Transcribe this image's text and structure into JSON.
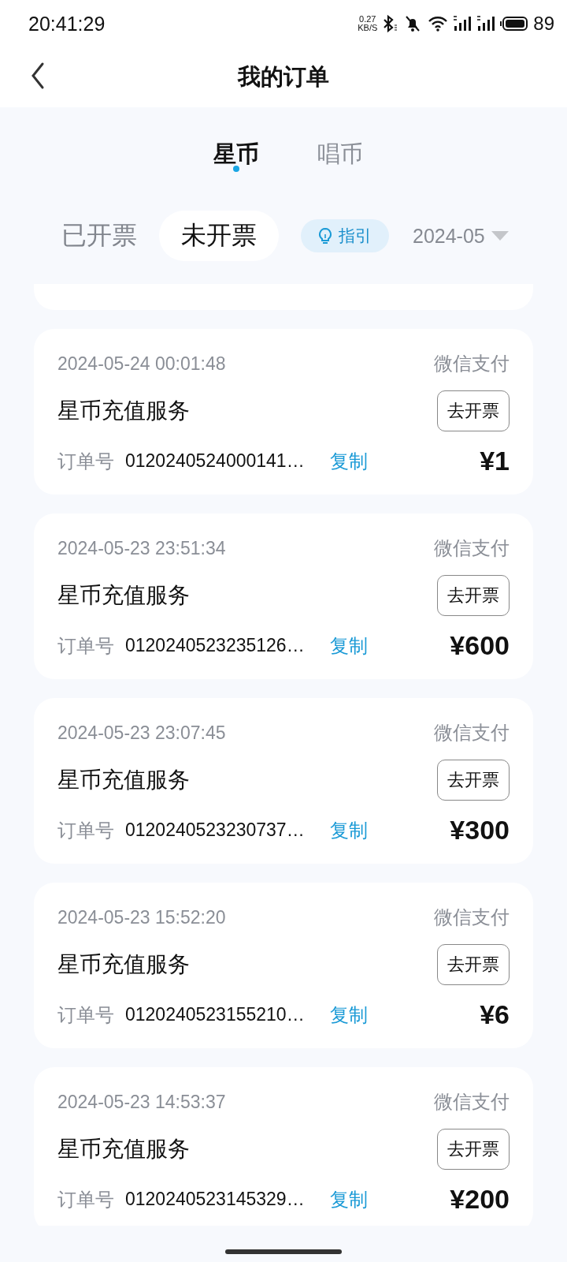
{
  "status_bar": {
    "time": "20:41:29",
    "net_speed_value": "0.27",
    "net_speed_unit": "KB/S",
    "battery": "89"
  },
  "header": {
    "title": "我的订单"
  },
  "tabs": [
    {
      "label": "星币",
      "selected": true
    },
    {
      "label": "唱币",
      "selected": false
    }
  ],
  "filters": [
    {
      "label": "已开票",
      "selected": false
    },
    {
      "label": "未开票",
      "selected": true
    }
  ],
  "guide_button": {
    "label": "指引"
  },
  "month_picker": {
    "value": "2024-05"
  },
  "orders": [
    {
      "time": "2024-05-24 00:01:48",
      "payment": "微信支付",
      "title": "星币充值服务",
      "invoice_button": "去开票",
      "order_label": "订单号",
      "order_no": "0120240524000141…",
      "copy": "复制",
      "amount": "¥1"
    },
    {
      "time": "2024-05-23 23:51:34",
      "payment": "微信支付",
      "title": "星币充值服务",
      "invoice_button": "去开票",
      "order_label": "订单号",
      "order_no": "0120240523235126…",
      "copy": "复制",
      "amount": "¥600"
    },
    {
      "time": "2024-05-23 23:07:45",
      "payment": "微信支付",
      "title": "星币充值服务",
      "invoice_button": "去开票",
      "order_label": "订单号",
      "order_no": "0120240523230737…",
      "copy": "复制",
      "amount": "¥300"
    },
    {
      "time": "2024-05-23 15:52:20",
      "payment": "微信支付",
      "title": "星币充值服务",
      "invoice_button": "去开票",
      "order_label": "订单号",
      "order_no": "0120240523155210…",
      "copy": "复制",
      "amount": "¥6"
    },
    {
      "time": "2024-05-23 14:53:37",
      "payment": "微信支付",
      "title": "星币充值服务",
      "invoice_button": "去开票",
      "order_label": "订单号",
      "order_no": "0120240523145329…",
      "copy": "复制",
      "amount": "¥200"
    }
  ]
}
